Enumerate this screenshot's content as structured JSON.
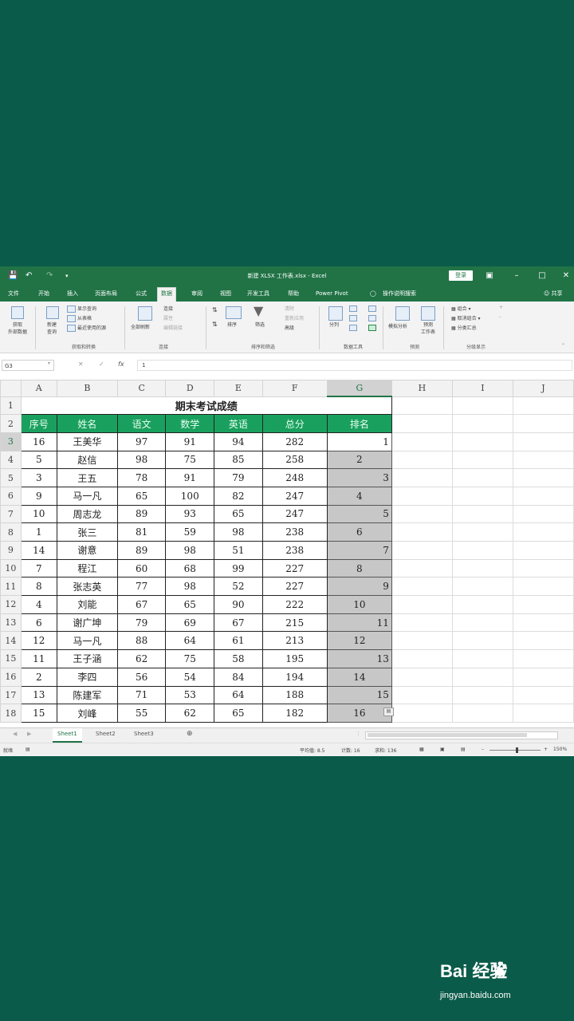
{
  "title_bar": {
    "document_title": "新建 XLSX 工作表.xlsx - Excel",
    "login_label": "登录",
    "qa_icons": [
      "save-icon",
      "undo-icon",
      "redo-icon",
      "customize-icon"
    ]
  },
  "menu": {
    "tabs": [
      "文件",
      "开始",
      "插入",
      "页面布局",
      "公式",
      "数据",
      "审阅",
      "视图",
      "开发工具",
      "帮助",
      "Power Pivot",
      "操作说明搜索"
    ],
    "active_tab": "数据",
    "share_label": "共享"
  },
  "ribbon": {
    "get_external": "获取\n外部数据",
    "new_query": "新建\n查询",
    "show_queries": "显示查询",
    "from_table": "从表格",
    "recent_sources": "最近使用的源",
    "group_get_transform": "获取和转换",
    "refresh_all": "全部刷新",
    "connections": "连接",
    "properties": "属性",
    "edit_links": "编辑链接",
    "group_connections": "连接",
    "sort": "排序",
    "filter": "筛选",
    "clear": "清除",
    "reapply": "重新应用",
    "advanced": "高级",
    "group_sort_filter": "排序和筛选",
    "text_to_columns": "分列",
    "group_data_tools": "数据工具",
    "what_if": "模拟分析",
    "forecast_sheet": "预测\n工作表",
    "group_forecast": "预测",
    "group_cmd": "组合",
    "ungroup": "取消组合",
    "subtotal": "分类汇总",
    "group_outline": "分级显示"
  },
  "formula_bar": {
    "name_box": "G3",
    "formula": "1"
  },
  "sheet": {
    "columns": [
      "A",
      "B",
      "C",
      "D",
      "E",
      "F",
      "G",
      "H",
      "I",
      "J"
    ],
    "title": "期末考试成绩",
    "headers": [
      "序号",
      "姓名",
      "语文",
      "数学",
      "英语",
      "总分",
      "排名"
    ],
    "rows": [
      {
        "row": "3",
        "no": "16",
        "name": "王美华",
        "chinese": "97",
        "math": "91",
        "english": "94",
        "total": "282",
        "rank": "1"
      },
      {
        "row": "4",
        "no": "5",
        "name": "赵信",
        "chinese": "98",
        "math": "75",
        "english": "85",
        "total": "258",
        "rank": "2"
      },
      {
        "row": "5",
        "no": "3",
        "name": "王五",
        "chinese": "78",
        "math": "91",
        "english": "79",
        "total": "248",
        "rank": "3"
      },
      {
        "row": "6",
        "no": "9",
        "name": "马一凡",
        "chinese": "65",
        "math": "100",
        "english": "82",
        "total": "247",
        "rank": "4"
      },
      {
        "row": "7",
        "no": "10",
        "name": "周志龙",
        "chinese": "89",
        "math": "93",
        "english": "65",
        "total": "247",
        "rank": "5"
      },
      {
        "row": "8",
        "no": "1",
        "name": "张三",
        "chinese": "81",
        "math": "59",
        "english": "98",
        "total": "238",
        "rank": "6"
      },
      {
        "row": "9",
        "no": "14",
        "name": "谢意",
        "chinese": "89",
        "math": "98",
        "english": "51",
        "total": "238",
        "rank": "7"
      },
      {
        "row": "10",
        "no": "7",
        "name": "程江",
        "chinese": "60",
        "math": "68",
        "english": "99",
        "total": "227",
        "rank": "8"
      },
      {
        "row": "11",
        "no": "8",
        "name": "张志英",
        "chinese": "77",
        "math": "98",
        "english": "52",
        "total": "227",
        "rank": "9"
      },
      {
        "row": "12",
        "no": "4",
        "name": "刘能",
        "chinese": "67",
        "math": "65",
        "english": "90",
        "total": "222",
        "rank": "10"
      },
      {
        "row": "13",
        "no": "6",
        "name": "谢广坤",
        "chinese": "79",
        "math": "69",
        "english": "67",
        "total": "215",
        "rank": "11"
      },
      {
        "row": "14",
        "no": "12",
        "name": "马一凡",
        "chinese": "88",
        "math": "64",
        "english": "61",
        "total": "213",
        "rank": "12"
      },
      {
        "row": "15",
        "no": "11",
        "name": "王子涵",
        "chinese": "62",
        "math": "75",
        "english": "58",
        "total": "195",
        "rank": "13"
      },
      {
        "row": "16",
        "no": "2",
        "name": "李四",
        "chinese": "56",
        "math": "54",
        "english": "84",
        "total": "194",
        "rank": "14"
      },
      {
        "row": "17",
        "no": "13",
        "name": "陈建军",
        "chinese": "71",
        "math": "53",
        "english": "64",
        "total": "188",
        "rank": "15"
      },
      {
        "row": "18",
        "no": "15",
        "name": "刘峰",
        "chinese": "55",
        "math": "62",
        "english": "65",
        "total": "182",
        "rank": "16"
      }
    ]
  },
  "sheet_tabs": [
    "Sheet1",
    "Sheet2",
    "Sheet3"
  ],
  "status_bar": {
    "mode": "就绪",
    "average": "平均值: 8.5",
    "count": "计数: 16",
    "sum": "求和: 136",
    "zoom": "150%"
  },
  "colors": {
    "excel_green": "#217346",
    "header_fill": "#1aa05e",
    "background": "#0b5b4a"
  },
  "watermark": {
    "logo": "Bai 经验",
    "url": "jingyan.baidu.com"
  }
}
